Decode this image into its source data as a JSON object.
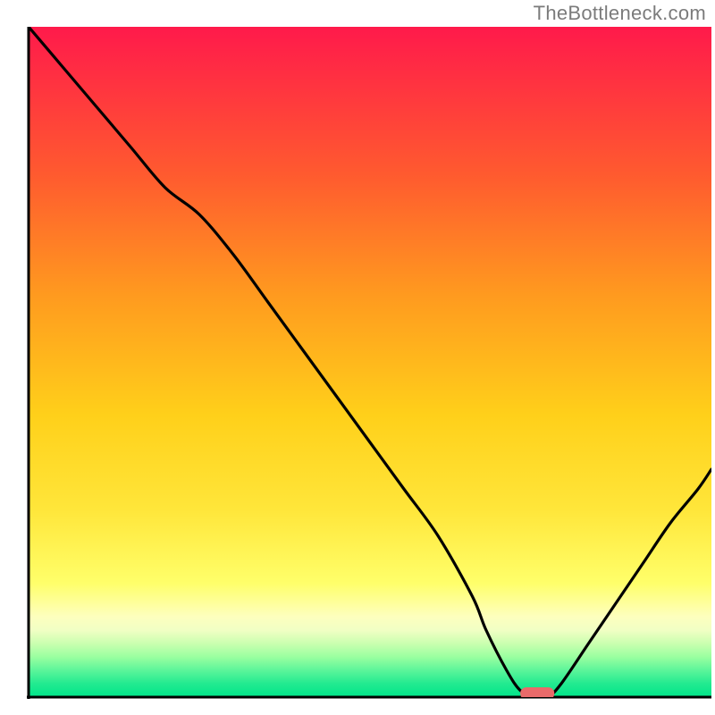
{
  "watermark": "TheBottleneck.com",
  "chart_data": {
    "type": "line",
    "title": "",
    "xlabel": "",
    "ylabel": "",
    "xlim": [
      0,
      100
    ],
    "ylim": [
      0,
      100
    ],
    "grid": false,
    "legend": false,
    "gradient_colors": {
      "top": "#ff1a4b",
      "mid_upper": "#ff9a1f",
      "mid": "#ffe01a",
      "mid_lower": "#ffff6a",
      "band_pale": "#fdffbe",
      "band_green1": "#c7ffb0",
      "band_green2": "#7effa0",
      "bottom": "#00e58a"
    },
    "series": [
      {
        "name": "bottleneck-curve",
        "color": "#000000",
        "x": [
          0,
          5,
          10,
          15,
          20,
          25,
          30,
          35,
          40,
          45,
          50,
          55,
          60,
          65,
          67,
          70,
          72,
          74,
          76,
          78,
          82,
          86,
          90,
          94,
          98,
          100
        ],
        "y": [
          100,
          94,
          88,
          82,
          76,
          72,
          66,
          59,
          52,
          45,
          38,
          31,
          24,
          15,
          10,
          4,
          1,
          0,
          0,
          2,
          8,
          14,
          20,
          26,
          31,
          34
        ]
      }
    ],
    "marker": {
      "name": "optimal-point",
      "x_start": 72,
      "x_end": 77,
      "y": 0,
      "color": "#e96a6a"
    },
    "axes": {
      "x_visible_range": [
        0,
        100
      ],
      "y_visible_range": [
        0,
        100
      ],
      "axis_color": "#000000"
    }
  }
}
